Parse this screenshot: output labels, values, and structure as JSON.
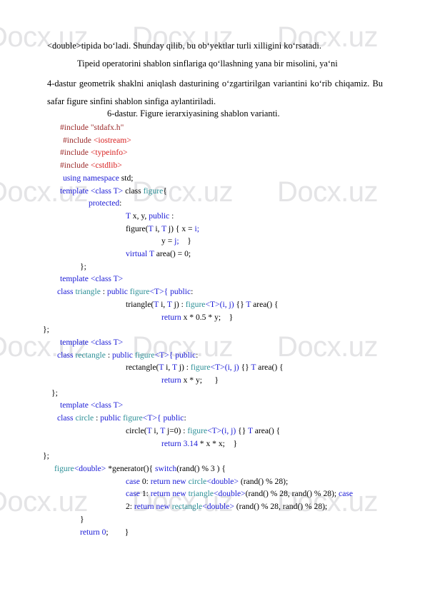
{
  "document": {
    "watermark_text": "Docx.uz",
    "body_paragraphs": [
      {
        "id": "p1",
        "text": "<double>tipida bo‘ladi. Shunday qilib, bu ob‘yektlar turli xilligini ko‘rsatadi."
      },
      {
        "id": "p2",
        "text": "Tipeid operatorini shablon sinflariga qo‘llashning yana bir misolini, ya‘ni"
      },
      {
        "id": "p3",
        "text": "4-dastur   geometrik   shaklni   aniqlash   dasturining   o‘zgartirilgan   variantini   ko‘rib chiqamiz. Bu safar figure sinfini shablon sinfiga aylantiriladi."
      }
    ],
    "caption": "6-dastur. Figure ierarxiyasining shablon varianti.",
    "code_language": "cpp",
    "code_lines": [
      {
        "id": "l1",
        "indent": 18,
        "tokens": [
          {
            "t": "#include ",
            "c": "t-pre"
          },
          {
            "t": "\"stdafx.h\"",
            "c": "t-str"
          }
        ]
      },
      {
        "id": "l2",
        "indent": 22,
        "tokens": [
          {
            "t": "#include ",
            "c": "t-pre"
          },
          {
            "t": "<iostream>",
            "c": "t-hdr"
          }
        ]
      },
      {
        "id": "l3",
        "indent": 18,
        "tokens": [
          {
            "t": "#include ",
            "c": "t-pre"
          },
          {
            "t": "<typeinfo>",
            "c": "t-hdr"
          }
        ]
      },
      {
        "id": "l4",
        "indent": 18,
        "tokens": [
          {
            "t": "#include ",
            "c": "t-pre"
          },
          {
            "t": "<cstdlib>",
            "c": "t-hdr"
          }
        ]
      },
      {
        "id": "l5",
        "indent": 22,
        "tokens": [
          {
            "t": "using namespace ",
            "c": "t-kw"
          },
          {
            "t": "std;",
            "c": "t-plain"
          }
        ]
      },
      {
        "id": "l6",
        "indent": 18,
        "tokens": [
          {
            "t": "template <",
            "c": "t-kw"
          },
          {
            "t": "class ",
            "c": "t-kw"
          },
          {
            "t": "T> ",
            "c": "t-kw"
          },
          {
            "t": "class ",
            "c": "t-plain"
          },
          {
            "t": "figure",
            "c": "t-type"
          },
          {
            "t": "{",
            "c": "t-plain"
          }
        ]
      },
      {
        "id": "l7",
        "indent": 58,
        "tokens": [
          {
            "t": "protected",
            "c": "t-kw"
          },
          {
            "t": ":",
            "c": "t-plain"
          }
        ]
      },
      {
        "id": "l8",
        "indent": 110,
        "tokens": [
          {
            "t": "T ",
            "c": "t-kw"
          },
          {
            "t": "x, y, ",
            "c": "t-plain"
          },
          {
            "t": "public",
            "c": "t-kw"
          },
          {
            "t": " :",
            "c": "t-plain"
          }
        ]
      },
      {
        "id": "l9",
        "indent": 110,
        "tokens": [
          {
            "t": "figure(",
            "c": "t-plain"
          },
          {
            "t": "T ",
            "c": "t-kw"
          },
          {
            "t": "i, ",
            "c": "t-plain"
          },
          {
            "t": "T ",
            "c": "t-kw"
          },
          {
            "t": "j) { x = ",
            "c": "t-plain"
          },
          {
            "t": "i;",
            "c": "t-kw"
          }
        ]
      },
      {
        "id": "l10",
        "indent": 160,
        "tokens": [
          {
            "t": "y = ",
            "c": "t-plain"
          },
          {
            "t": "j;",
            "c": "t-kw"
          },
          {
            "t": "    }",
            "c": "t-plain"
          }
        ]
      },
      {
        "id": "l11",
        "indent": 110,
        "tokens": [
          {
            "t": "virtual ",
            "c": "t-kw"
          },
          {
            "t": "T ",
            "c": "t-kw"
          },
          {
            "t": "area() = 0;",
            "c": "t-plain"
          }
        ]
      },
      {
        "id": "l12",
        "indent": 46,
        "tokens": [
          {
            "t": "};",
            "c": "t-plain"
          }
        ]
      },
      {
        "id": "l13",
        "indent": 18,
        "tokens": [
          {
            "t": "template <",
            "c": "t-kw"
          },
          {
            "t": "class ",
            "c": "t-kw"
          },
          {
            "t": "T>",
            "c": "t-kw"
          }
        ]
      },
      {
        "id": "l14",
        "indent": 14,
        "tokens": [
          {
            "t": "class ",
            "c": "t-kw"
          },
          {
            "t": "triangle",
            "c": "t-type"
          },
          {
            "t": " : ",
            "c": "t-plain"
          },
          {
            "t": "public ",
            "c": "t-kw"
          },
          {
            "t": "figure",
            "c": "t-type"
          },
          {
            "t": "<",
            "c": "t-kw"
          },
          {
            "t": "T",
            "c": "t-kw"
          },
          {
            "t": ">{ ",
            "c": "t-kw"
          },
          {
            "t": "public",
            "c": "t-kw"
          },
          {
            "t": ":",
            "c": "t-plain"
          }
        ]
      },
      {
        "id": "l15",
        "indent": 110,
        "tokens": [
          {
            "t": "triangle(",
            "c": "t-plain"
          },
          {
            "t": "T ",
            "c": "t-kw"
          },
          {
            "t": "i, ",
            "c": "t-plain"
          },
          {
            "t": "T ",
            "c": "t-kw"
          },
          {
            "t": "j) : ",
            "c": "t-plain"
          },
          {
            "t": "figure",
            "c": "t-type"
          },
          {
            "t": "<",
            "c": "t-kw"
          },
          {
            "t": "T",
            "c": "t-kw"
          },
          {
            "t": ">",
            "c": "t-kw"
          },
          {
            "t": "(i, j)",
            "c": "t-kw"
          },
          {
            "t": " {} ",
            "c": "t-plain"
          },
          {
            "t": "T ",
            "c": "t-kw"
          },
          {
            "t": "area() {",
            "c": "t-plain"
          }
        ]
      },
      {
        "id": "l16",
        "indent": 160,
        "tokens": [
          {
            "t": "return ",
            "c": "t-kw"
          },
          {
            "t": "x * 0.5 * y;    }",
            "c": "t-plain"
          }
        ]
      },
      {
        "id": "l17",
        "indent": -6,
        "tokens": [
          {
            "t": "};",
            "c": "t-plain"
          }
        ]
      },
      {
        "id": "l18",
        "indent": 18,
        "tokens": [
          {
            "t": "template <",
            "c": "t-kw"
          },
          {
            "t": "class ",
            "c": "t-kw"
          },
          {
            "t": "T>",
            "c": "t-kw"
          }
        ]
      },
      {
        "id": "l19",
        "indent": 14,
        "tokens": [
          {
            "t": "class ",
            "c": "t-kw"
          },
          {
            "t": "rectangle",
            "c": "t-type"
          },
          {
            "t": " : ",
            "c": "t-plain"
          },
          {
            "t": "public ",
            "c": "t-kw"
          },
          {
            "t": "figure",
            "c": "t-type"
          },
          {
            "t": "<",
            "c": "t-kw"
          },
          {
            "t": "T",
            "c": "t-kw"
          },
          {
            "t": ">{ ",
            "c": "t-kw"
          },
          {
            "t": "public",
            "c": "t-kw"
          },
          {
            "t": ":",
            "c": "t-plain"
          }
        ]
      },
      {
        "id": "l20",
        "indent": 110,
        "tokens": [
          {
            "t": "rectangle(",
            "c": "t-plain"
          },
          {
            "t": "T ",
            "c": "t-kw"
          },
          {
            "t": "i, ",
            "c": "t-plain"
          },
          {
            "t": "T ",
            "c": "t-kw"
          },
          {
            "t": "j) : ",
            "c": "t-plain"
          },
          {
            "t": "figure",
            "c": "t-type"
          },
          {
            "t": "<",
            "c": "t-kw"
          },
          {
            "t": "T",
            "c": "t-kw"
          },
          {
            "t": ">",
            "c": "t-kw"
          },
          {
            "t": "(i, j)",
            "c": "t-kw"
          },
          {
            "t": " {} ",
            "c": "t-plain"
          },
          {
            "t": "T ",
            "c": "t-kw"
          },
          {
            "t": "area() {",
            "c": "t-plain"
          }
        ]
      },
      {
        "id": "l21",
        "indent": 160,
        "tokens": [
          {
            "t": "return ",
            "c": "t-kw"
          },
          {
            "t": "x * y;      }",
            "c": "t-plain"
          }
        ]
      },
      {
        "id": "l22",
        "indent": 6,
        "tokens": [
          {
            "t": "};",
            "c": "t-plain"
          }
        ]
      },
      {
        "id": "l23",
        "indent": 18,
        "tokens": [
          {
            "t": "template <",
            "c": "t-kw"
          },
          {
            "t": "class ",
            "c": "t-kw"
          },
          {
            "t": "T>",
            "c": "t-kw"
          }
        ]
      },
      {
        "id": "l24",
        "indent": 14,
        "tokens": [
          {
            "t": "class ",
            "c": "t-kw"
          },
          {
            "t": "circle",
            "c": "t-type"
          },
          {
            "t": " : ",
            "c": "t-plain"
          },
          {
            "t": "public ",
            "c": "t-kw"
          },
          {
            "t": "figure",
            "c": "t-type"
          },
          {
            "t": "<",
            "c": "t-kw"
          },
          {
            "t": "T",
            "c": "t-kw"
          },
          {
            "t": ">{ ",
            "c": "t-kw"
          },
          {
            "t": "public",
            "c": "t-kw"
          },
          {
            "t": ":",
            "c": "t-plain"
          }
        ]
      },
      {
        "id": "l25",
        "indent": 110,
        "tokens": [
          {
            "t": "circle(",
            "c": "t-plain"
          },
          {
            "t": "T ",
            "c": "t-kw"
          },
          {
            "t": "i, ",
            "c": "t-plain"
          },
          {
            "t": "T ",
            "c": "t-kw"
          },
          {
            "t": "j=0) : ",
            "c": "t-plain"
          },
          {
            "t": "figure",
            "c": "t-type"
          },
          {
            "t": "<",
            "c": "t-kw"
          },
          {
            "t": "T",
            "c": "t-kw"
          },
          {
            "t": ">",
            "c": "t-kw"
          },
          {
            "t": "(i, j)",
            "c": "t-kw"
          },
          {
            "t": " {} ",
            "c": "t-plain"
          },
          {
            "t": "T ",
            "c": "t-kw"
          },
          {
            "t": "area() {",
            "c": "t-plain"
          }
        ]
      },
      {
        "id": "l26",
        "indent": 160,
        "tokens": [
          {
            "t": "return ",
            "c": "t-kw"
          },
          {
            "t": "3.14",
            "c": "t-num"
          },
          {
            "t": " * x * x;    }",
            "c": "t-plain"
          }
        ]
      },
      {
        "id": "l27",
        "indent": -6,
        "tokens": [
          {
            "t": "};",
            "c": "t-plain"
          }
        ]
      },
      {
        "id": "l28",
        "indent": 10,
        "tokens": [
          {
            "t": "figure",
            "c": "t-type"
          },
          {
            "t": "<",
            "c": "t-kw"
          },
          {
            "t": "double",
            "c": "t-kw"
          },
          {
            "t": "> ",
            "c": "t-kw"
          },
          {
            "t": "*generator(){ ",
            "c": "t-plain"
          },
          {
            "t": "switch",
            "c": "t-kw"
          },
          {
            "t": "(rand() % 3 ) {",
            "c": "t-plain"
          }
        ]
      },
      {
        "id": "l29",
        "indent": 110,
        "tokens": [
          {
            "t": "case ",
            "c": "t-kw"
          },
          {
            "t": "0",
            "c": "t-plain"
          },
          {
            "t": ": ",
            "c": "t-plain"
          },
          {
            "t": "return new ",
            "c": "t-kw"
          },
          {
            "t": "circle",
            "c": "t-type"
          },
          {
            "t": "<",
            "c": "t-kw"
          },
          {
            "t": "double",
            "c": "t-kw"
          },
          {
            "t": ">",
            "c": "t-kw"
          },
          {
            "t": " (rand() % 28);",
            "c": "t-plain"
          }
        ]
      },
      {
        "id": "l30",
        "indent": 110,
        "tokens": [
          {
            "t": "case ",
            "c": "t-kw"
          },
          {
            "t": "1",
            "c": "t-plain"
          },
          {
            "t": ": ",
            "c": "t-plain"
          },
          {
            "t": "return new ",
            "c": "t-kw"
          },
          {
            "t": "triangle",
            "c": "t-type"
          },
          {
            "t": "<",
            "c": "t-kw"
          },
          {
            "t": "double",
            "c": "t-kw"
          },
          {
            "t": ">",
            "c": "t-kw"
          },
          {
            "t": "(rand() % 28, rand() % 28); ",
            "c": "t-plain"
          },
          {
            "t": "case",
            "c": "t-kw"
          }
        ]
      },
      {
        "id": "l31",
        "indent": 110,
        "tokens": [
          {
            "t": "2",
            "c": "t-plain"
          },
          {
            "t": ": ",
            "c": "t-plain"
          },
          {
            "t": "return new ",
            "c": "t-kw"
          },
          {
            "t": "rectangle",
            "c": "t-type"
          },
          {
            "t": "<",
            "c": "t-kw"
          },
          {
            "t": "double",
            "c": "t-kw"
          },
          {
            "t": "> ",
            "c": "t-kw"
          },
          {
            "t": "(rand() % 28, rand() % 28);",
            "c": "t-plain"
          }
        ]
      },
      {
        "id": "l32",
        "indent": 46,
        "tokens": [
          {
            "t": "}",
            "c": "t-plain"
          }
        ]
      },
      {
        "id": "l33",
        "indent": 46,
        "tokens": [
          {
            "t": "return ",
            "c": "t-kw"
          },
          {
            "t": "0",
            "c": "t-kw"
          },
          {
            "t": ";        }",
            "c": "t-plain"
          }
        ]
      }
    ]
  }
}
